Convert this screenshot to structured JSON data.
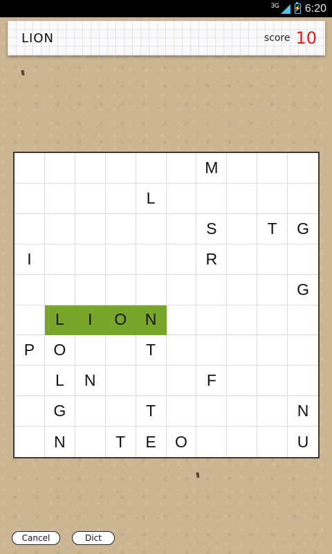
{
  "status_bar": {
    "network_type": "3G",
    "time": "6:20",
    "signal_icon": "signal-icon",
    "battery_icon": "battery-charging-icon",
    "battery_glyph": "⚡",
    "icon_color": "#4ec2ea"
  },
  "header": {
    "current_word": "LION",
    "score_label": "score",
    "score_value": "10",
    "score_color": "#e01b1b"
  },
  "board": {
    "rows": 10,
    "cols": 10,
    "highlight_color": "#78a62a",
    "grid": [
      [
        "",
        "",
        "",
        "",
        "",
        "",
        "M",
        "",
        "",
        ""
      ],
      [
        "",
        "",
        "",
        "",
        "L",
        "",
        "",
        "",
        "",
        ""
      ],
      [
        "",
        "",
        "",
        "",
        "",
        "",
        "S",
        "",
        "T",
        "G"
      ],
      [
        "I",
        "",
        "",
        "",
        "",
        "",
        "R",
        "",
        "",
        ""
      ],
      [
        "",
        "",
        "",
        "",
        "",
        "",
        "",
        "",
        "",
        "G"
      ],
      [
        "",
        "L",
        "I",
        "O",
        "N",
        "",
        "",
        "",
        "",
        ""
      ],
      [
        "P",
        "O",
        "",
        "",
        "T",
        "",
        "",
        "",
        "",
        ""
      ],
      [
        "",
        "L",
        "N",
        "",
        "",
        "",
        "F",
        "",
        "",
        ""
      ],
      [
        "",
        "G",
        "",
        "",
        "T",
        "",
        "",
        "",
        "",
        "N"
      ],
      [
        "",
        "N",
        "",
        "T",
        "E",
        "O",
        "",
        "",
        "",
        "U"
      ]
    ],
    "highlighted_word": "LION"
  },
  "buttons": {
    "cancel_label": "Cancel",
    "dict_label": "Dict"
  }
}
